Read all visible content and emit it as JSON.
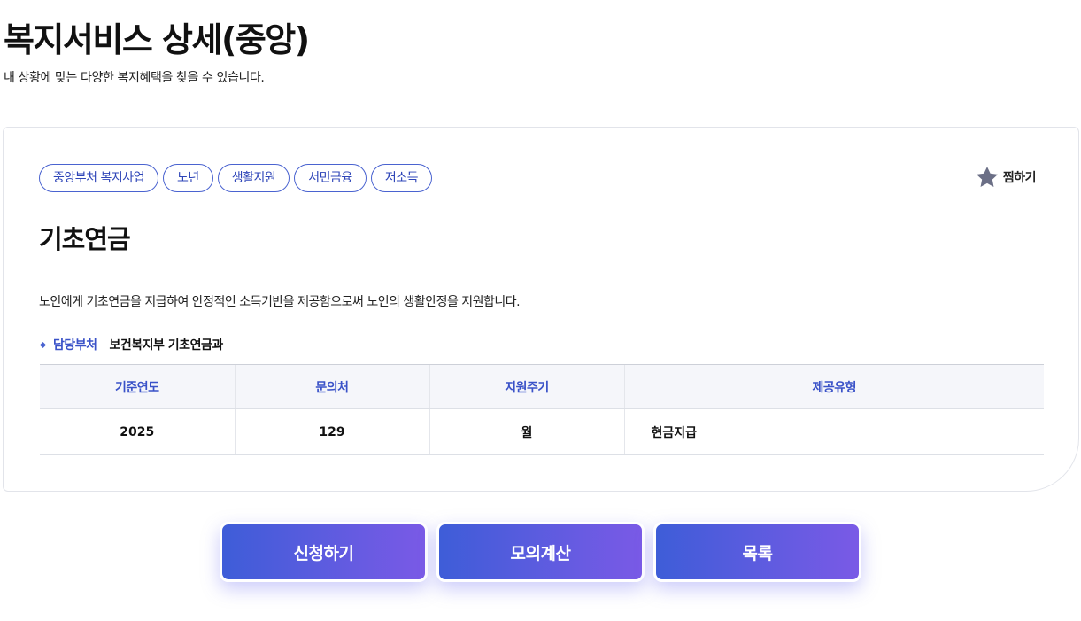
{
  "header": {
    "title": "복지서비스 상세(중앙)",
    "subtitle": "내 상황에 맞는 다양한 복지혜택을 찾을 수 있습니다."
  },
  "service": {
    "tags": [
      "중앙부처 복지사업",
      "노년",
      "생활지원",
      "서민금융",
      "저소득"
    ],
    "favorite_label": "찜하기",
    "title": "기초연금",
    "description": "노인에게 기초연금을 지급하여 안정적인 소득기반을 제공함으로써 노인의 생활안정을 지원합니다.",
    "department": {
      "label": "담당부처",
      "value": "보건복지부 기초연금과"
    },
    "table": {
      "headers": [
        "기준연도",
        "문의처",
        "지원주기",
        "제공유형"
      ],
      "row": [
        "2025",
        "129",
        "월",
        "현금지급"
      ]
    }
  },
  "actions": {
    "apply": "신청하기",
    "simulate": "모의계산",
    "list": "목록"
  },
  "colors": {
    "accent": "#3a52c8",
    "button_gradient_start": "#3e5dd8",
    "button_gradient_end": "#7a5ae6",
    "star": "#6b6f86"
  }
}
